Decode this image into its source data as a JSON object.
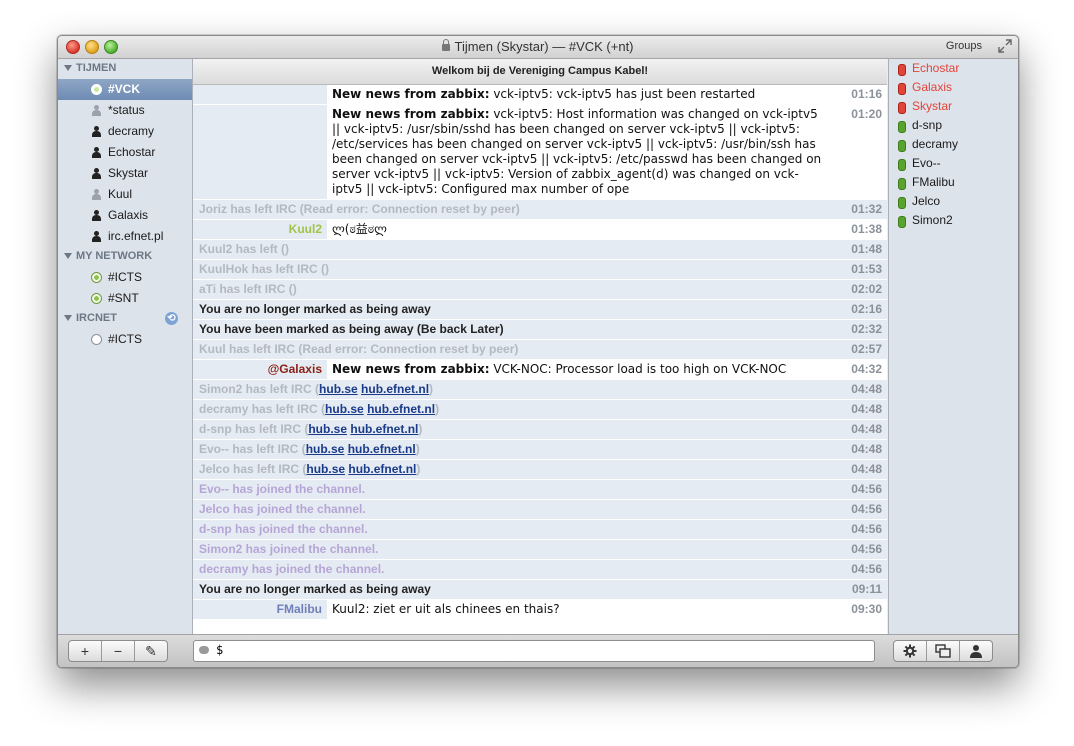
{
  "window": {
    "title": "Tijmen (Skystar) — #VCK (+nt)",
    "groups_label": "Groups"
  },
  "sidebar": {
    "groups": [
      {
        "name": "TIJMEN",
        "items": [
          {
            "label": "#VCK",
            "type": "channel",
            "selected": true
          },
          {
            "label": "*status",
            "type": "user-dim"
          },
          {
            "label": "decramy",
            "type": "user"
          },
          {
            "label": "Echostar",
            "type": "user"
          },
          {
            "label": "Skystar",
            "type": "user"
          },
          {
            "label": "Kuul",
            "type": "user-dim"
          },
          {
            "label": "Galaxis",
            "type": "user"
          },
          {
            "label": "irc.efnet.pl",
            "type": "user"
          }
        ]
      },
      {
        "name": "MY NETWORK",
        "items": [
          {
            "label": "#ICTS",
            "type": "channel"
          },
          {
            "label": "#SNT",
            "type": "channel"
          }
        ]
      },
      {
        "name": "IRCNET",
        "items": [
          {
            "label": "#ICTS",
            "type": "channel-off"
          }
        ]
      }
    ]
  },
  "topic": "Welkom bij de Vereniging Campus Kabel!",
  "messages": [
    {
      "kind": "msg",
      "nick": "",
      "bold": "New news from zabbix:",
      "text": " vck-iptv5: vck-iptv5 has just been restarted",
      "time": "01:16"
    },
    {
      "kind": "msg",
      "nick": "",
      "bold": "New news from zabbix:",
      "text": " vck-iptv5: Host information was changed on vck-iptv5 || vck-iptv5: /usr/sbin/sshd has been changed on server vck-iptv5 || vck-iptv5: /etc/services has been changed on server vck-iptv5 || vck-iptv5: /usr/bin/ssh has been changed on server vck-iptv5 || vck-iptv5: /etc/passwd has been changed on server vck-iptv5 || vck-iptv5: Version of zabbix_agent(d) was changed on vck-iptv5 || vck-iptv5: Configured max number of ope",
      "time": "01:20"
    },
    {
      "kind": "event",
      "style": "grey",
      "text": "Joriz has left IRC (Read error: Connection reset by peer)",
      "time": "01:32"
    },
    {
      "kind": "msg",
      "nick": "Kuul2",
      "nick_color": "#a2c34a",
      "bold": "",
      "text": "ლ(ಠ益ಠლ",
      "time": "01:38"
    },
    {
      "kind": "event",
      "style": "grey",
      "text": "Kuul2 has left ()",
      "time": "01:48"
    },
    {
      "kind": "event",
      "style": "grey",
      "text": "KuulHok has left IRC ()",
      "time": "01:53"
    },
    {
      "kind": "event",
      "style": "grey",
      "text": "aTi has left IRC ()",
      "time": "02:02"
    },
    {
      "kind": "event",
      "style": "dark",
      "text": "You are no longer marked as being away",
      "time": "02:16"
    },
    {
      "kind": "event",
      "style": "dark",
      "text": "You have been marked as being away (Be back Later)",
      "time": "02:32"
    },
    {
      "kind": "event",
      "style": "grey",
      "text": "Kuul has left IRC (Read error: Connection reset by peer)",
      "time": "02:57"
    },
    {
      "kind": "msg",
      "nick": "@Galaxis",
      "nick_color": "#8a1f14",
      "bold": "New news from zabbix:",
      "text": " VCK-NOC: Processor load is too high on VCK-NOC",
      "time": "04:32"
    },
    {
      "kind": "event",
      "style": "grey",
      "text": "Simon2 has left IRC (",
      "link1": "hub.se",
      "link2": "hub.efnet.nl",
      "tail": ")",
      "time": "04:48"
    },
    {
      "kind": "event",
      "style": "grey",
      "text": "decramy has left IRC (",
      "link1": "hub.se",
      "link2": "hub.efnet.nl",
      "tail": ")",
      "time": "04:48"
    },
    {
      "kind": "event",
      "style": "grey",
      "text": "d-snp has left IRC (",
      "link1": "hub.se",
      "link2": "hub.efnet.nl",
      "tail": ")",
      "time": "04:48"
    },
    {
      "kind": "event",
      "style": "grey",
      "text": "Evo-- has left IRC (",
      "link1": "hub.se",
      "link2": "hub.efnet.nl",
      "tail": ")",
      "time": "04:48"
    },
    {
      "kind": "event",
      "style": "grey",
      "text": "Jelco has left IRC (",
      "link1": "hub.se",
      "link2": "hub.efnet.nl",
      "tail": ")",
      "time": "04:48"
    },
    {
      "kind": "event",
      "style": "purple",
      "text": "Evo-- has joined the channel.",
      "time": "04:56"
    },
    {
      "kind": "event",
      "style": "purple",
      "text": "Jelco has joined the channel.",
      "time": "04:56"
    },
    {
      "kind": "event",
      "style": "purple",
      "text": "d-snp has joined the channel.",
      "time": "04:56"
    },
    {
      "kind": "event",
      "style": "purple",
      "text": "Simon2 has joined the channel.",
      "time": "04:56"
    },
    {
      "kind": "event",
      "style": "purple",
      "text": "decramy has joined the channel.",
      "time": "04:56"
    },
    {
      "kind": "event",
      "style": "dark",
      "text": "You are no longer marked as being away",
      "time": "09:11"
    },
    {
      "kind": "msg",
      "nick": "FMalibu",
      "nick_color": "#6f7fb9",
      "bold": "",
      "text": "Kuul2: ziet er uit als chinees en thais?",
      "time": "09:30"
    }
  ],
  "users": [
    {
      "name": "Echostar",
      "op": true
    },
    {
      "name": "Galaxis",
      "op": true
    },
    {
      "name": "Skystar",
      "op": true
    },
    {
      "name": "d-snp",
      "op": false
    },
    {
      "name": "decramy",
      "op": false
    },
    {
      "name": "Evo--",
      "op": false
    },
    {
      "name": "FMalibu",
      "op": false
    },
    {
      "name": "Jelco",
      "op": false
    },
    {
      "name": "Simon2",
      "op": false
    }
  ],
  "input": {
    "value": "$"
  },
  "bottom": {
    "left_buttons": [
      "+",
      "−",
      "✎"
    ],
    "right_buttons": [
      "gear-icon",
      "windows-icon",
      "user-icon"
    ]
  }
}
